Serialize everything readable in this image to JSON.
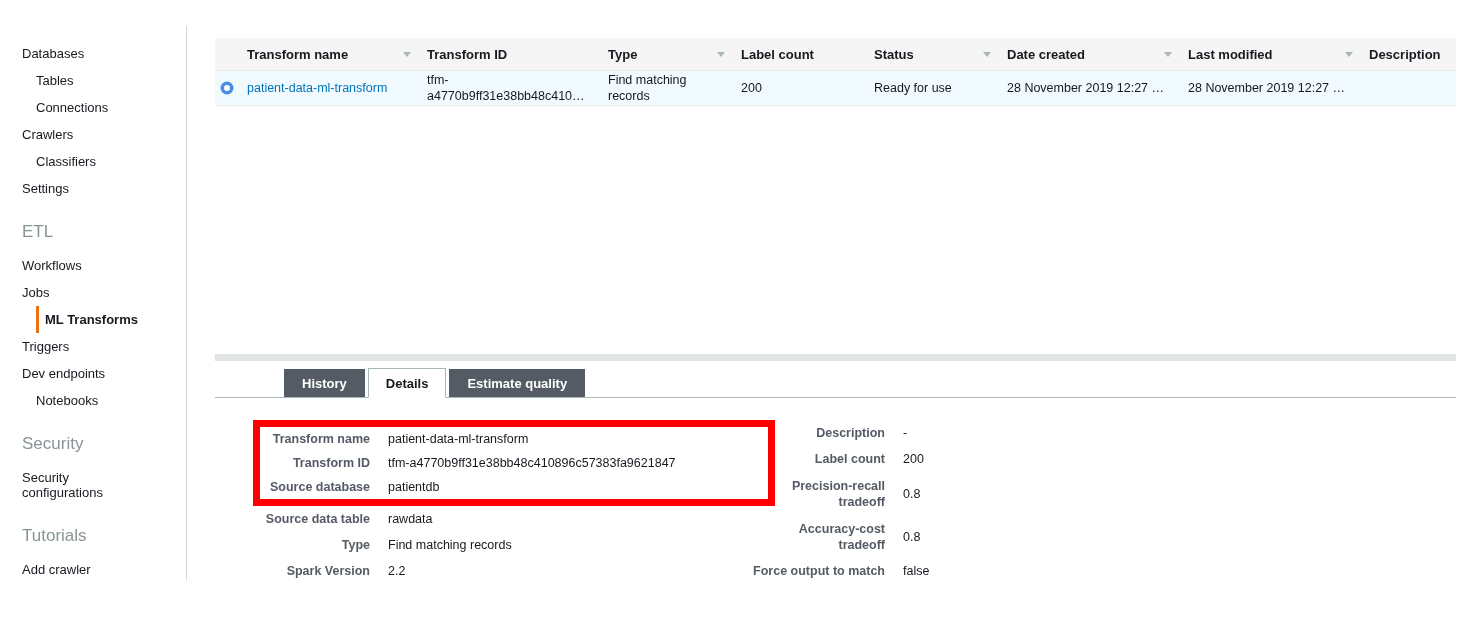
{
  "sidebar": {
    "sections": [
      {
        "items": [
          {
            "label": "Databases",
            "selected": false,
            "children": [
              {
                "label": "Tables",
                "selected": false
              },
              {
                "label": "Connections",
                "selected": false
              }
            ]
          },
          {
            "label": "Crawlers",
            "selected": false,
            "children": [
              {
                "label": "Classifiers",
                "selected": false
              }
            ]
          },
          {
            "label": "Settings",
            "selected": false
          }
        ]
      },
      {
        "heading": "ETL",
        "items": [
          {
            "label": "Workflows",
            "selected": false
          },
          {
            "label": "Jobs",
            "selected": false,
            "children": [
              {
                "label": "ML Transforms",
                "selected": true
              }
            ]
          },
          {
            "label": "Triggers",
            "selected": false
          },
          {
            "label": "Dev endpoints",
            "selected": false,
            "children": [
              {
                "label": "Notebooks",
                "selected": false
              }
            ]
          }
        ]
      },
      {
        "heading": "Security",
        "items": [
          {
            "label": "Security configurations",
            "selected": false
          }
        ]
      },
      {
        "heading": "Tutorials",
        "items": [
          {
            "label": "Add crawler",
            "selected": false
          }
        ]
      }
    ]
  },
  "table": {
    "columns": [
      {
        "label": "Transform name",
        "sortable": true
      },
      {
        "label": "Transform ID",
        "sortable": false
      },
      {
        "label": "Type",
        "sortable": true
      },
      {
        "label": "Label count",
        "sortable": false
      },
      {
        "label": "Status",
        "sortable": true
      },
      {
        "label": "Date created",
        "sortable": true
      },
      {
        "label": "Last modified",
        "sortable": true
      },
      {
        "label": "Description",
        "sortable": false
      }
    ],
    "rows": [
      {
        "selected": true,
        "cells": [
          "patient-data-ml-transform",
          "tfm-\na4770b9ff31e38bb48c410…",
          "Find matching\nrecords",
          "200",
          "Ready for use",
          "28 November 2019 12:27 …",
          "28 November 2019 12:27 …",
          null
        ]
      }
    ]
  },
  "tabs": [
    {
      "label": "History",
      "selected": false
    },
    {
      "label": "Details",
      "selected": true
    },
    {
      "label": "Estimate quality",
      "selected": false
    }
  ],
  "details": {
    "left": [
      {
        "label": "Transform name",
        "value": "patient-data-ml-transform",
        "highlighted": true
      },
      {
        "label": "Transform ID",
        "value": "tfm-a4770b9ff31e38bb48c410896c57383fa9621847",
        "highlighted": true
      },
      {
        "label": "Source database",
        "value": "patientdb",
        "highlighted": true
      },
      {
        "label": "Source data table",
        "value": "rawdata",
        "highlighted": false
      },
      {
        "label": "Type",
        "value": "Find matching records",
        "highlighted": false
      },
      {
        "label": "Spark Version",
        "value": "2.2",
        "highlighted": false
      }
    ],
    "right": [
      {
        "label": "Description",
        "value": "-"
      },
      {
        "label": "Label count",
        "value": "200"
      },
      {
        "label": "Precision-recall\ntradeoff",
        "value": "0.8"
      },
      {
        "label": "Accuracy-cost\ntradeoff",
        "value": "0.8"
      },
      {
        "label": "Force output to match",
        "value": "false"
      }
    ]
  }
}
